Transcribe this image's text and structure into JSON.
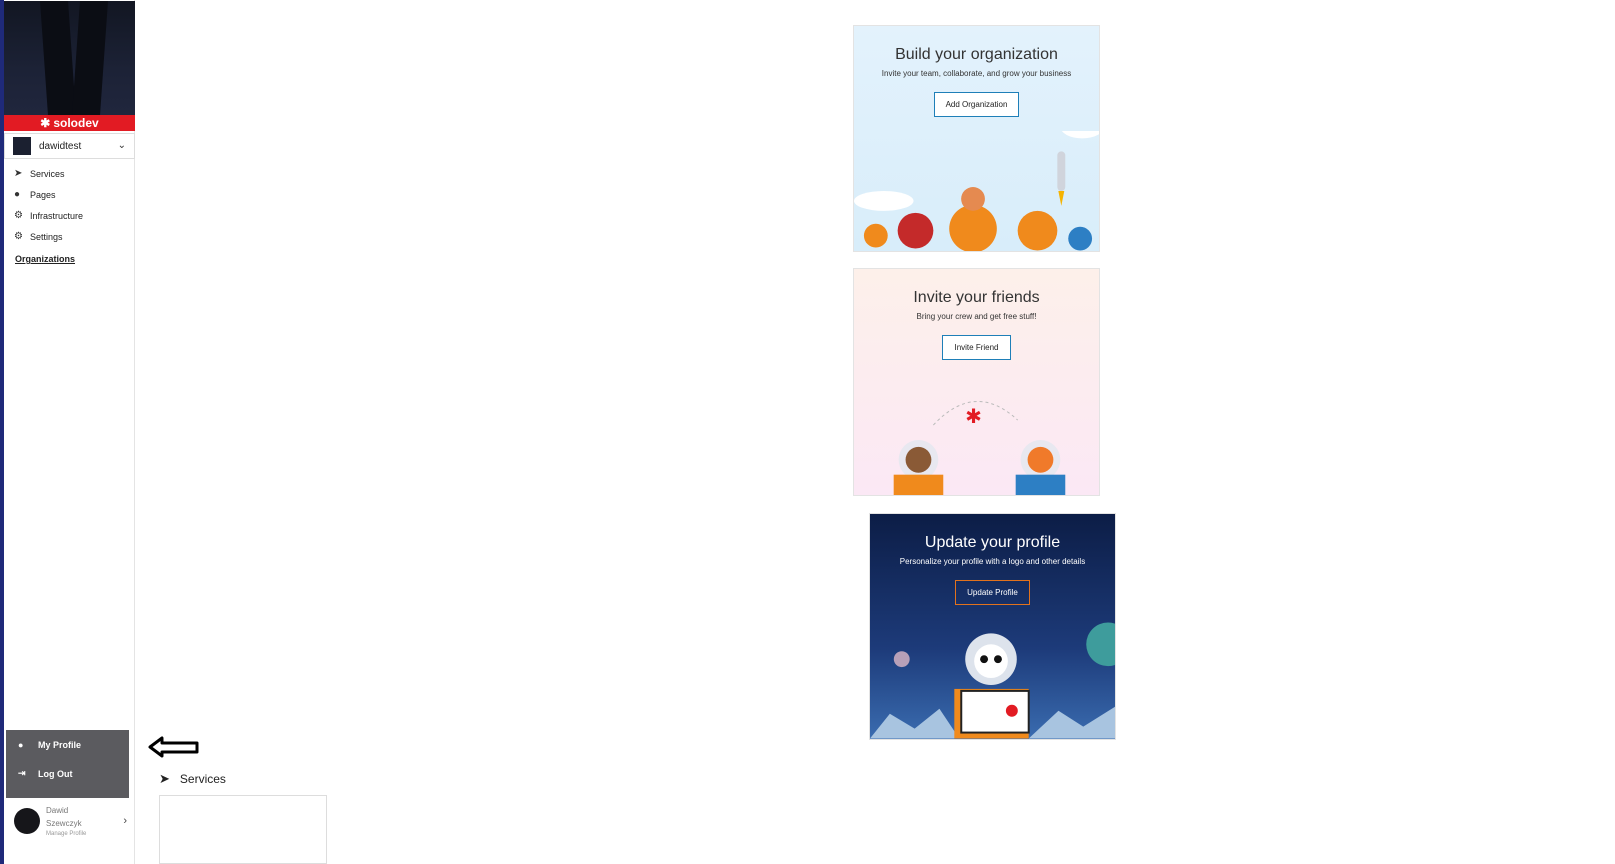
{
  "sidebar": {
    "brand": "solodev",
    "org_name": "dawidtest",
    "nav": [
      {
        "label": "Services",
        "icon": "paper-plane-icon"
      },
      {
        "label": "Pages",
        "icon": "globe-icon"
      },
      {
        "label": "Infrastructure",
        "icon": "cogs-icon"
      },
      {
        "label": "Settings",
        "icon": "gear-icon"
      }
    ],
    "organizations_link": "Organizations",
    "profile_menu": [
      {
        "label": "My Profile",
        "icon": "user-icon"
      },
      {
        "label": "Log Out",
        "icon": "sign-out-icon"
      }
    ],
    "user": {
      "first": "Dawid",
      "last": "Szewczyk",
      "sub": "Manage Profile"
    }
  },
  "main": {
    "services_heading": "Services"
  },
  "cards": [
    {
      "title": "Build your organization",
      "subtitle": "Invite your team, collaborate, and grow your business",
      "button": "Add Organization"
    },
    {
      "title": "Invite your friends",
      "subtitle": "Bring your crew and get free stuff!",
      "button": "Invite Friend"
    },
    {
      "title": "Update your profile",
      "subtitle": "Personalize your profile with a logo and other details",
      "button": "Update Profile"
    }
  ],
  "colors": {
    "brand_red": "#e21b23",
    "menu_gray": "#5b5b5f",
    "button_blue": "#1e7fb8",
    "button_orange": "#e2721d"
  }
}
